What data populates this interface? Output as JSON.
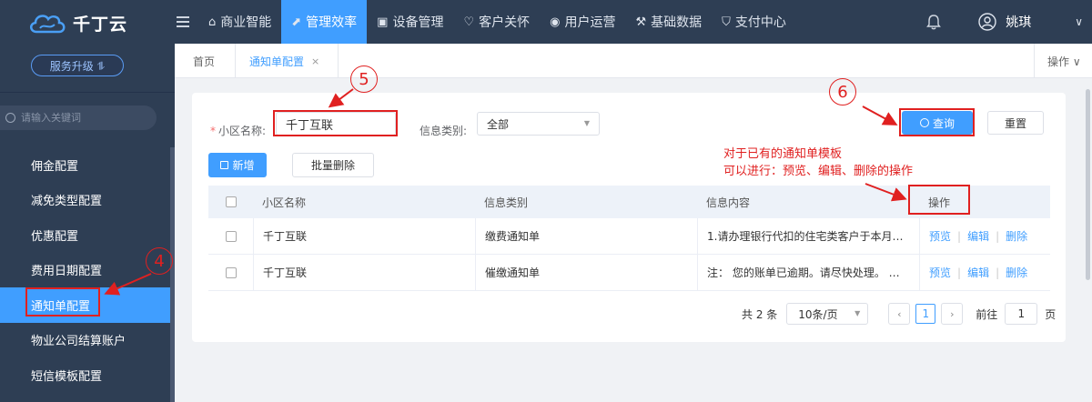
{
  "brand": {
    "name": "千丁云"
  },
  "sidebar": {
    "upgrade_label": "服务升级 ⥮",
    "search_placeholder": "请输入关键词",
    "items": [
      {
        "label": "佣金配置"
      },
      {
        "label": "减免类型配置"
      },
      {
        "label": "优惠配置"
      },
      {
        "label": "费用日期配置"
      },
      {
        "label": "通知单配置"
      },
      {
        "label": "物业公司结算账户"
      },
      {
        "label": "短信模板配置"
      }
    ]
  },
  "topnav": {
    "items": [
      {
        "label": "商业智能",
        "icon": "building-icon"
      },
      {
        "label": "管理效率",
        "icon": "chart-icon"
      },
      {
        "label": "设备管理",
        "icon": "device-icon"
      },
      {
        "label": "客户关怀",
        "icon": "heart-icon"
      },
      {
        "label": "用户运营",
        "icon": "user-ops-icon"
      },
      {
        "label": "基础数据",
        "icon": "wrench-icon"
      },
      {
        "label": "支付中心",
        "icon": "shield-icon"
      }
    ],
    "user_name": "姚琪"
  },
  "tabs": {
    "home": "首页",
    "active": "通知单配置",
    "close": "×",
    "ops": "操作 ∨"
  },
  "filters": {
    "community_label": "小区名称:",
    "community_value": "千丁互联",
    "type_label": "信息类别:",
    "type_value": "全部",
    "query_label": "查询",
    "reset_label": "重置"
  },
  "actions": {
    "add_label": "新增",
    "bulk_delete_label": "批量删除"
  },
  "table": {
    "headers": {
      "name": "小区名称",
      "type": "信息类别",
      "content": "信息内容",
      "ops": "操作"
    },
    "rows": [
      {
        "name": "千丁互联",
        "type": "缴费通知单",
        "content": "1.请办理银行代扣的住宅类客户于本月…"
      },
      {
        "name": "千丁互联",
        "type": "催缴通知单",
        "content": "注： 您的账单已逾期。请尽快处理。 …"
      }
    ],
    "op_preview": "预览",
    "op_edit": "编辑",
    "op_delete": "删除",
    "sep": "|"
  },
  "pagination": {
    "total": "共 2 条",
    "page_size": "10条/页",
    "current": "1",
    "goto_label": "前往",
    "goto_value": "1",
    "page_unit": "页"
  },
  "annotations": {
    "n4": "4",
    "n5": "5",
    "n6": "6",
    "note_line1": "对于已有的通知单模板",
    "note_line2": "可以进行：预览、编辑、删除的操作"
  }
}
